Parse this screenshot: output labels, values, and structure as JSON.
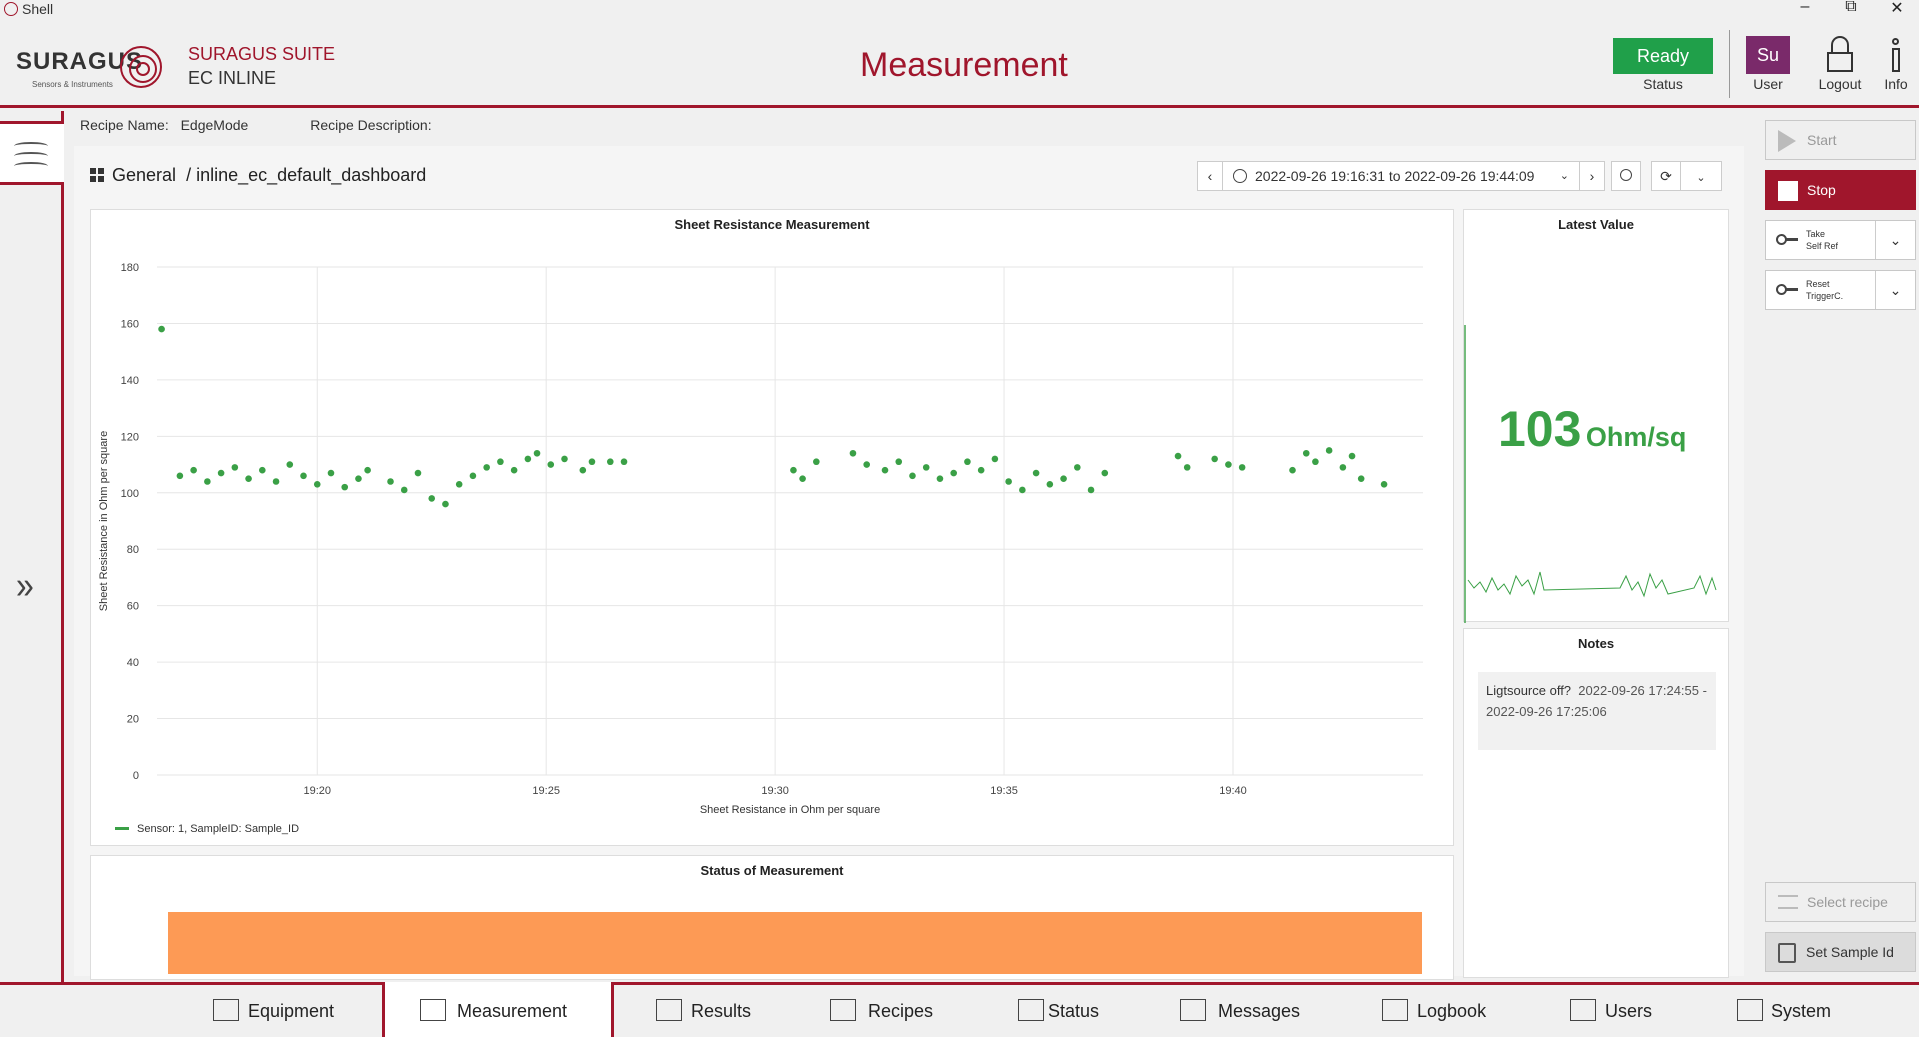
{
  "window": {
    "title": "Shell",
    "minimize": "–",
    "restore": "⧉",
    "close": "✕"
  },
  "header": {
    "logo_text": "SURAGUS",
    "logo_sub": "Sensors & Instruments",
    "suite_line1": "SURAGUS SUITE",
    "suite_line2": "EC INLINE",
    "page_title": "Measurement",
    "status_button": "Ready",
    "status_label": "Status",
    "status_color": "#20a04a",
    "user_avatar": "Su",
    "user_label": "User",
    "logout_label": "Logout",
    "info_label": "Info",
    "accent_color": "#a0162c"
  },
  "recipe": {
    "name_label": "Recipe Name:",
    "name_value": "EdgeMode",
    "description_label": "Recipe Description:",
    "description_value": ""
  },
  "dashboard": {
    "folder": "General",
    "separator": "/",
    "name": "inline_ec_default_dashboard",
    "time_range": "2022-09-26 19:16:31 to 2022-09-26 19:44:09"
  },
  "panels": {
    "sheet_resistance_title": "Sheet Resistance Measurement",
    "latest_value_title": "Latest Value",
    "latest_value": "103",
    "latest_unit": "Ohm/sq",
    "notes_title": "Notes",
    "note": {
      "text": "Ligtsource off?",
      "time": "2022-09-26 17:24:55 - 2022-09-26 17:25:06"
    },
    "status_title": "Status of Measurement",
    "status_color": "#fd9a55"
  },
  "controls": {
    "start": "Start",
    "stop": "Stop",
    "take_self_ref_line1": "Take",
    "take_self_ref_line2": "Self Ref",
    "reset_trigger_line1": "Reset",
    "reset_trigger_line2": "TriggerC.",
    "select_recipe": "Select recipe",
    "set_sample_id": "Set Sample Id"
  },
  "nav": {
    "items": [
      {
        "label": "Equipment",
        "icon": "equipment-icon"
      },
      {
        "label": "Measurement",
        "icon": "measurement-icon",
        "active": true
      },
      {
        "label": "Results",
        "icon": "results-icon"
      },
      {
        "label": "Recipes",
        "icon": "recipes-icon"
      },
      {
        "label": "Status",
        "icon": "status-icon"
      },
      {
        "label": "Messages",
        "icon": "messages-icon"
      },
      {
        "label": "Logbook",
        "icon": "logbook-icon"
      },
      {
        "label": "Users",
        "icon": "users-icon"
      },
      {
        "label": "System",
        "icon": "system-icon"
      }
    ]
  },
  "chart_data": {
    "type": "scatter",
    "title": "Sheet Resistance Measurement",
    "xlabel": "Sheet Resistance in Ohm per square",
    "ylabel": "Sheet Resistance in Ohm per square",
    "x_ticks": [
      "19:20",
      "19:25",
      "19:30",
      "19:35",
      "19:40"
    ],
    "x_tick_minutes": [
      20,
      25,
      30,
      35,
      40
    ],
    "xlim_minutes": [
      16.5,
      44.15
    ],
    "ylim": [
      0,
      180
    ],
    "y_ticks": [
      0,
      20,
      40,
      60,
      80,
      100,
      120,
      140,
      160,
      180
    ],
    "grid": true,
    "legend": "bottom-left",
    "series": [
      {
        "name": "Sensor: 1, SampleID: Sample_ID",
        "color": "#3aa046",
        "points": [
          [
            16.6,
            158
          ],
          [
            17.0,
            106
          ],
          [
            17.3,
            108
          ],
          [
            17.6,
            104
          ],
          [
            17.9,
            107
          ],
          [
            18.2,
            109
          ],
          [
            18.5,
            105
          ],
          [
            18.8,
            108
          ],
          [
            19.1,
            104
          ],
          [
            19.4,
            110
          ],
          [
            19.7,
            106
          ],
          [
            20.0,
            103
          ],
          [
            20.3,
            107
          ],
          [
            20.6,
            102
          ],
          [
            20.9,
            105
          ],
          [
            21.1,
            108
          ],
          [
            21.6,
            104
          ],
          [
            21.9,
            101
          ],
          [
            22.2,
            107
          ],
          [
            22.5,
            98
          ],
          [
            22.8,
            96
          ],
          [
            23.1,
            103
          ],
          [
            23.4,
            106
          ],
          [
            23.7,
            109
          ],
          [
            24.0,
            111
          ],
          [
            24.3,
            108
          ],
          [
            24.6,
            112
          ],
          [
            24.8,
            114
          ],
          [
            25.1,
            110
          ],
          [
            25.4,
            112
          ],
          [
            25.8,
            108
          ],
          [
            26.0,
            111
          ],
          [
            26.4,
            111
          ],
          [
            26.7,
            111
          ],
          [
            30.4,
            108
          ],
          [
            30.6,
            105
          ],
          [
            30.9,
            111
          ],
          [
            31.7,
            114
          ],
          [
            32.0,
            110
          ],
          [
            32.4,
            108
          ],
          [
            32.7,
            111
          ],
          [
            33.0,
            106
          ],
          [
            33.3,
            109
          ],
          [
            33.6,
            105
          ],
          [
            33.9,
            107
          ],
          [
            34.2,
            111
          ],
          [
            34.5,
            108
          ],
          [
            34.8,
            112
          ],
          [
            35.1,
            104
          ],
          [
            35.4,
            101
          ],
          [
            35.7,
            107
          ],
          [
            36.0,
            103
          ],
          [
            36.3,
            105
          ],
          [
            36.6,
            109
          ],
          [
            36.9,
            101
          ],
          [
            37.2,
            107
          ],
          [
            38.8,
            113
          ],
          [
            39.0,
            109
          ],
          [
            39.6,
            112
          ],
          [
            39.9,
            110
          ],
          [
            40.2,
            109
          ],
          [
            41.3,
            108
          ],
          [
            41.6,
            114
          ],
          [
            41.8,
            111
          ],
          [
            42.1,
            115
          ],
          [
            42.4,
            109
          ],
          [
            42.6,
            113
          ],
          [
            42.8,
            105
          ],
          [
            43.3,
            103
          ]
        ]
      }
    ]
  }
}
